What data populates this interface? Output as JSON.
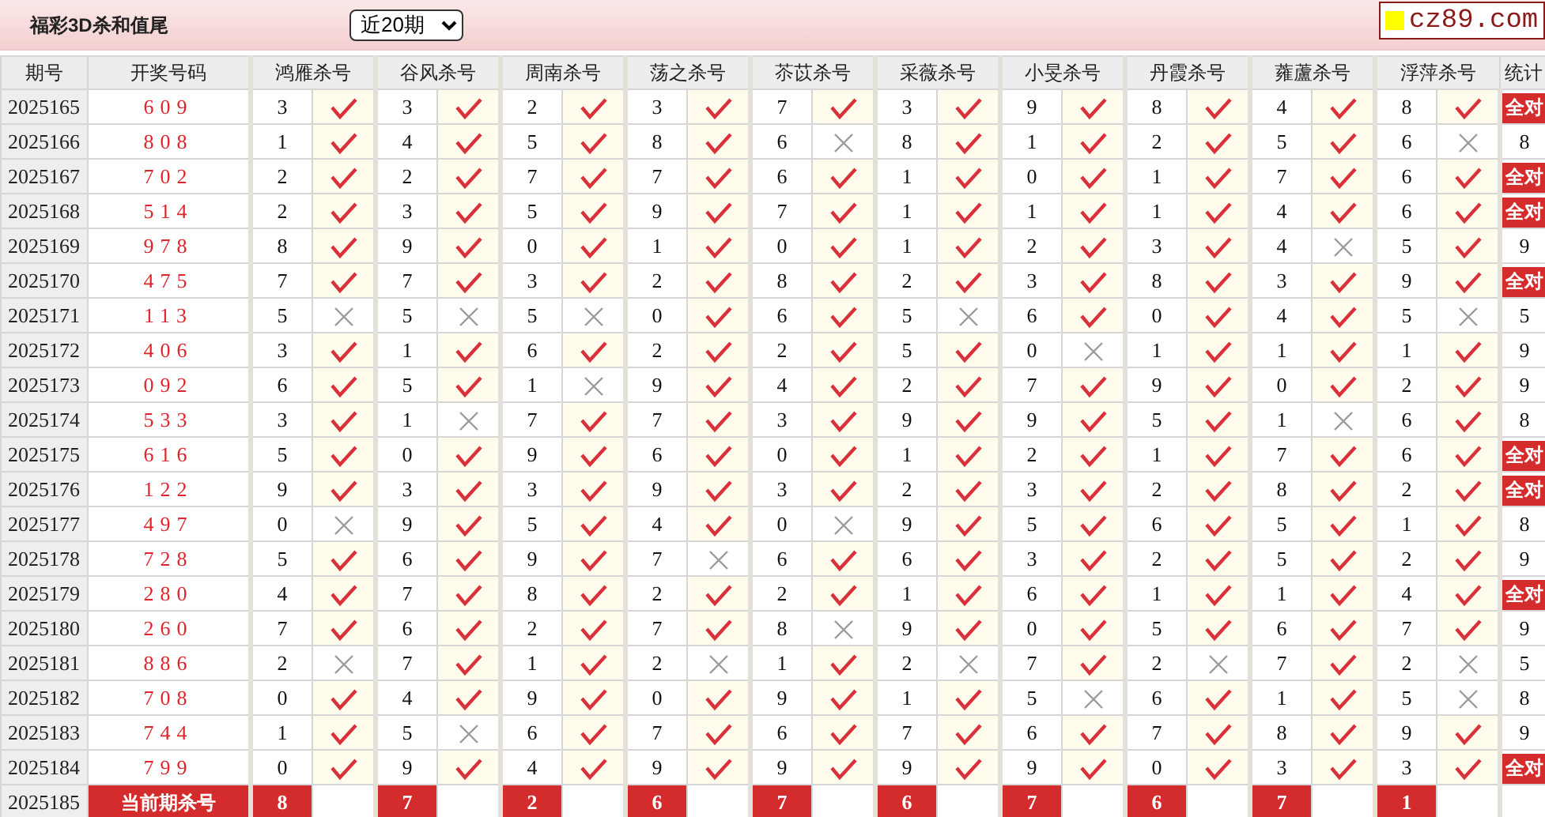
{
  "header": {
    "title": "福彩3D杀和值尾",
    "period_select": {
      "value": "近20期"
    },
    "logo": "cz89.com"
  },
  "table": {
    "columns": [
      "期号",
      "开奖号码",
      "鸿雁杀号",
      "谷风杀号",
      "周南杀号",
      "荡之杀号",
      "苶苡杀号",
      "采薇杀号",
      "小旻杀号",
      "丹霞杀号",
      "蕹蘆杀号",
      "浮萍杀号",
      "统计"
    ],
    "rows": [
      {
        "period": "2025165",
        "draw": "609",
        "picks": [
          {
            "n": "3",
            "hit": true
          },
          {
            "n": "3",
            "hit": true
          },
          {
            "n": "2",
            "hit": true
          },
          {
            "n": "3",
            "hit": true
          },
          {
            "n": "7",
            "hit": true
          },
          {
            "n": "3",
            "hit": true
          },
          {
            "n": "9",
            "hit": true
          },
          {
            "n": "8",
            "hit": true
          },
          {
            "n": "4",
            "hit": true
          },
          {
            "n": "8",
            "hit": true
          }
        ],
        "stat": "全对",
        "all_hit": true
      },
      {
        "period": "2025166",
        "draw": "808",
        "picks": [
          {
            "n": "1",
            "hit": true
          },
          {
            "n": "4",
            "hit": true
          },
          {
            "n": "5",
            "hit": true
          },
          {
            "n": "8",
            "hit": true
          },
          {
            "n": "6",
            "hit": false
          },
          {
            "n": "8",
            "hit": true
          },
          {
            "n": "1",
            "hit": true
          },
          {
            "n": "2",
            "hit": true
          },
          {
            "n": "5",
            "hit": true
          },
          {
            "n": "6",
            "hit": false
          }
        ],
        "stat": "8",
        "all_hit": false
      },
      {
        "period": "2025167",
        "draw": "702",
        "picks": [
          {
            "n": "2",
            "hit": true
          },
          {
            "n": "2",
            "hit": true
          },
          {
            "n": "7",
            "hit": true
          },
          {
            "n": "7",
            "hit": true
          },
          {
            "n": "6",
            "hit": true
          },
          {
            "n": "1",
            "hit": true
          },
          {
            "n": "0",
            "hit": true
          },
          {
            "n": "1",
            "hit": true
          },
          {
            "n": "7",
            "hit": true
          },
          {
            "n": "6",
            "hit": true
          }
        ],
        "stat": "全对",
        "all_hit": true
      },
      {
        "period": "2025168",
        "draw": "514",
        "picks": [
          {
            "n": "2",
            "hit": true
          },
          {
            "n": "3",
            "hit": true
          },
          {
            "n": "5",
            "hit": true
          },
          {
            "n": "9",
            "hit": true
          },
          {
            "n": "7",
            "hit": true
          },
          {
            "n": "1",
            "hit": true
          },
          {
            "n": "1",
            "hit": true
          },
          {
            "n": "1",
            "hit": true
          },
          {
            "n": "4",
            "hit": true
          },
          {
            "n": "6",
            "hit": true
          }
        ],
        "stat": "全对",
        "all_hit": true
      },
      {
        "period": "2025169",
        "draw": "978",
        "picks": [
          {
            "n": "8",
            "hit": true
          },
          {
            "n": "9",
            "hit": true
          },
          {
            "n": "0",
            "hit": true
          },
          {
            "n": "1",
            "hit": true
          },
          {
            "n": "0",
            "hit": true
          },
          {
            "n": "1",
            "hit": true
          },
          {
            "n": "2",
            "hit": true
          },
          {
            "n": "3",
            "hit": true
          },
          {
            "n": "4",
            "hit": false
          },
          {
            "n": "5",
            "hit": true
          }
        ],
        "stat": "9",
        "all_hit": false
      },
      {
        "period": "2025170",
        "draw": "475",
        "picks": [
          {
            "n": "7",
            "hit": true
          },
          {
            "n": "7",
            "hit": true
          },
          {
            "n": "3",
            "hit": true
          },
          {
            "n": "2",
            "hit": true
          },
          {
            "n": "8",
            "hit": true
          },
          {
            "n": "2",
            "hit": true
          },
          {
            "n": "3",
            "hit": true
          },
          {
            "n": "8",
            "hit": true
          },
          {
            "n": "3",
            "hit": true
          },
          {
            "n": "9",
            "hit": true
          }
        ],
        "stat": "全对",
        "all_hit": true
      },
      {
        "period": "2025171",
        "draw": "113",
        "picks": [
          {
            "n": "5",
            "hit": false
          },
          {
            "n": "5",
            "hit": false
          },
          {
            "n": "5",
            "hit": false
          },
          {
            "n": "0",
            "hit": true
          },
          {
            "n": "6",
            "hit": true
          },
          {
            "n": "5",
            "hit": false
          },
          {
            "n": "6",
            "hit": true
          },
          {
            "n": "0",
            "hit": true
          },
          {
            "n": "4",
            "hit": true
          },
          {
            "n": "5",
            "hit": false
          }
        ],
        "stat": "5",
        "all_hit": false
      },
      {
        "period": "2025172",
        "draw": "406",
        "picks": [
          {
            "n": "3",
            "hit": true
          },
          {
            "n": "1",
            "hit": true
          },
          {
            "n": "6",
            "hit": true
          },
          {
            "n": "2",
            "hit": true
          },
          {
            "n": "2",
            "hit": true
          },
          {
            "n": "5",
            "hit": true
          },
          {
            "n": "0",
            "hit": false
          },
          {
            "n": "1",
            "hit": true
          },
          {
            "n": "1",
            "hit": true
          },
          {
            "n": "1",
            "hit": true
          }
        ],
        "stat": "9",
        "all_hit": false
      },
      {
        "period": "2025173",
        "draw": "092",
        "picks": [
          {
            "n": "6",
            "hit": true
          },
          {
            "n": "5",
            "hit": true
          },
          {
            "n": "1",
            "hit": false
          },
          {
            "n": "9",
            "hit": true
          },
          {
            "n": "4",
            "hit": true
          },
          {
            "n": "2",
            "hit": true
          },
          {
            "n": "7",
            "hit": true
          },
          {
            "n": "9",
            "hit": true
          },
          {
            "n": "0",
            "hit": true
          },
          {
            "n": "2",
            "hit": true
          }
        ],
        "stat": "9",
        "all_hit": false
      },
      {
        "period": "2025174",
        "draw": "533",
        "picks": [
          {
            "n": "3",
            "hit": true
          },
          {
            "n": "1",
            "hit": false
          },
          {
            "n": "7",
            "hit": true
          },
          {
            "n": "7",
            "hit": true
          },
          {
            "n": "3",
            "hit": true
          },
          {
            "n": "9",
            "hit": true
          },
          {
            "n": "9",
            "hit": true
          },
          {
            "n": "5",
            "hit": true
          },
          {
            "n": "1",
            "hit": false
          },
          {
            "n": "6",
            "hit": true
          }
        ],
        "stat": "8",
        "all_hit": false
      },
      {
        "period": "2025175",
        "draw": "616",
        "picks": [
          {
            "n": "5",
            "hit": true
          },
          {
            "n": "0",
            "hit": true
          },
          {
            "n": "9",
            "hit": true
          },
          {
            "n": "6",
            "hit": true
          },
          {
            "n": "0",
            "hit": true
          },
          {
            "n": "1",
            "hit": true
          },
          {
            "n": "2",
            "hit": true
          },
          {
            "n": "1",
            "hit": true
          },
          {
            "n": "7",
            "hit": true
          },
          {
            "n": "6",
            "hit": true
          }
        ],
        "stat": "全对",
        "all_hit": true
      },
      {
        "period": "2025176",
        "draw": "122",
        "picks": [
          {
            "n": "9",
            "hit": true
          },
          {
            "n": "3",
            "hit": true
          },
          {
            "n": "3",
            "hit": true
          },
          {
            "n": "9",
            "hit": true
          },
          {
            "n": "3",
            "hit": true
          },
          {
            "n": "2",
            "hit": true
          },
          {
            "n": "3",
            "hit": true
          },
          {
            "n": "2",
            "hit": true
          },
          {
            "n": "8",
            "hit": true
          },
          {
            "n": "2",
            "hit": true
          }
        ],
        "stat": "全对",
        "all_hit": true
      },
      {
        "period": "2025177",
        "draw": "497",
        "picks": [
          {
            "n": "0",
            "hit": false
          },
          {
            "n": "9",
            "hit": true
          },
          {
            "n": "5",
            "hit": true
          },
          {
            "n": "4",
            "hit": true
          },
          {
            "n": "0",
            "hit": false
          },
          {
            "n": "9",
            "hit": true
          },
          {
            "n": "5",
            "hit": true
          },
          {
            "n": "6",
            "hit": true
          },
          {
            "n": "5",
            "hit": true
          },
          {
            "n": "1",
            "hit": true
          }
        ],
        "stat": "8",
        "all_hit": false
      },
      {
        "period": "2025178",
        "draw": "728",
        "picks": [
          {
            "n": "5",
            "hit": true
          },
          {
            "n": "6",
            "hit": true
          },
          {
            "n": "9",
            "hit": true
          },
          {
            "n": "7",
            "hit": false
          },
          {
            "n": "6",
            "hit": true
          },
          {
            "n": "6",
            "hit": true
          },
          {
            "n": "3",
            "hit": true
          },
          {
            "n": "2",
            "hit": true
          },
          {
            "n": "5",
            "hit": true
          },
          {
            "n": "2",
            "hit": true
          }
        ],
        "stat": "9",
        "all_hit": false
      },
      {
        "period": "2025179",
        "draw": "280",
        "picks": [
          {
            "n": "4",
            "hit": true
          },
          {
            "n": "7",
            "hit": true
          },
          {
            "n": "8",
            "hit": true
          },
          {
            "n": "2",
            "hit": true
          },
          {
            "n": "2",
            "hit": true
          },
          {
            "n": "1",
            "hit": true
          },
          {
            "n": "6",
            "hit": true
          },
          {
            "n": "1",
            "hit": true
          },
          {
            "n": "1",
            "hit": true
          },
          {
            "n": "4",
            "hit": true
          }
        ],
        "stat": "全对",
        "all_hit": true
      },
      {
        "period": "2025180",
        "draw": "260",
        "picks": [
          {
            "n": "7",
            "hit": true
          },
          {
            "n": "6",
            "hit": true
          },
          {
            "n": "2",
            "hit": true
          },
          {
            "n": "7",
            "hit": true
          },
          {
            "n": "8",
            "hit": false
          },
          {
            "n": "9",
            "hit": true
          },
          {
            "n": "0",
            "hit": true
          },
          {
            "n": "5",
            "hit": true
          },
          {
            "n": "6",
            "hit": true
          },
          {
            "n": "7",
            "hit": true
          }
        ],
        "stat": "9",
        "all_hit": false
      },
      {
        "period": "2025181",
        "draw": "886",
        "picks": [
          {
            "n": "2",
            "hit": false
          },
          {
            "n": "7",
            "hit": true
          },
          {
            "n": "1",
            "hit": true
          },
          {
            "n": "2",
            "hit": false
          },
          {
            "n": "1",
            "hit": true
          },
          {
            "n": "2",
            "hit": false
          },
          {
            "n": "7",
            "hit": true
          },
          {
            "n": "2",
            "hit": false
          },
          {
            "n": "7",
            "hit": true
          },
          {
            "n": "2",
            "hit": false
          }
        ],
        "stat": "5",
        "all_hit": false
      },
      {
        "period": "2025182",
        "draw": "708",
        "picks": [
          {
            "n": "0",
            "hit": true
          },
          {
            "n": "4",
            "hit": true
          },
          {
            "n": "9",
            "hit": true
          },
          {
            "n": "0",
            "hit": true
          },
          {
            "n": "9",
            "hit": true
          },
          {
            "n": "1",
            "hit": true
          },
          {
            "n": "5",
            "hit": false
          },
          {
            "n": "6",
            "hit": true
          },
          {
            "n": "1",
            "hit": true
          },
          {
            "n": "5",
            "hit": false
          }
        ],
        "stat": "8",
        "all_hit": false
      },
      {
        "period": "2025183",
        "draw": "744",
        "picks": [
          {
            "n": "1",
            "hit": true
          },
          {
            "n": "5",
            "hit": false
          },
          {
            "n": "6",
            "hit": true
          },
          {
            "n": "7",
            "hit": true
          },
          {
            "n": "6",
            "hit": true
          },
          {
            "n": "7",
            "hit": true
          },
          {
            "n": "6",
            "hit": true
          },
          {
            "n": "7",
            "hit": true
          },
          {
            "n": "8",
            "hit": true
          },
          {
            "n": "9",
            "hit": true
          }
        ],
        "stat": "9",
        "all_hit": false
      },
      {
        "period": "2025184",
        "draw": "799",
        "picks": [
          {
            "n": "0",
            "hit": true
          },
          {
            "n": "9",
            "hit": true
          },
          {
            "n": "4",
            "hit": true
          },
          {
            "n": "9",
            "hit": true
          },
          {
            "n": "9",
            "hit": true
          },
          {
            "n": "9",
            "hit": true
          },
          {
            "n": "9",
            "hit": true
          },
          {
            "n": "0",
            "hit": true
          },
          {
            "n": "3",
            "hit": true
          },
          {
            "n": "3",
            "hit": true
          }
        ],
        "stat": "全对",
        "all_hit": true
      }
    ],
    "current": {
      "period": "2025185",
      "label": "当前期杀号",
      "picks": [
        "8",
        "7",
        "2",
        "6",
        "7",
        "6",
        "7",
        "6",
        "7",
        "1"
      ]
    }
  }
}
